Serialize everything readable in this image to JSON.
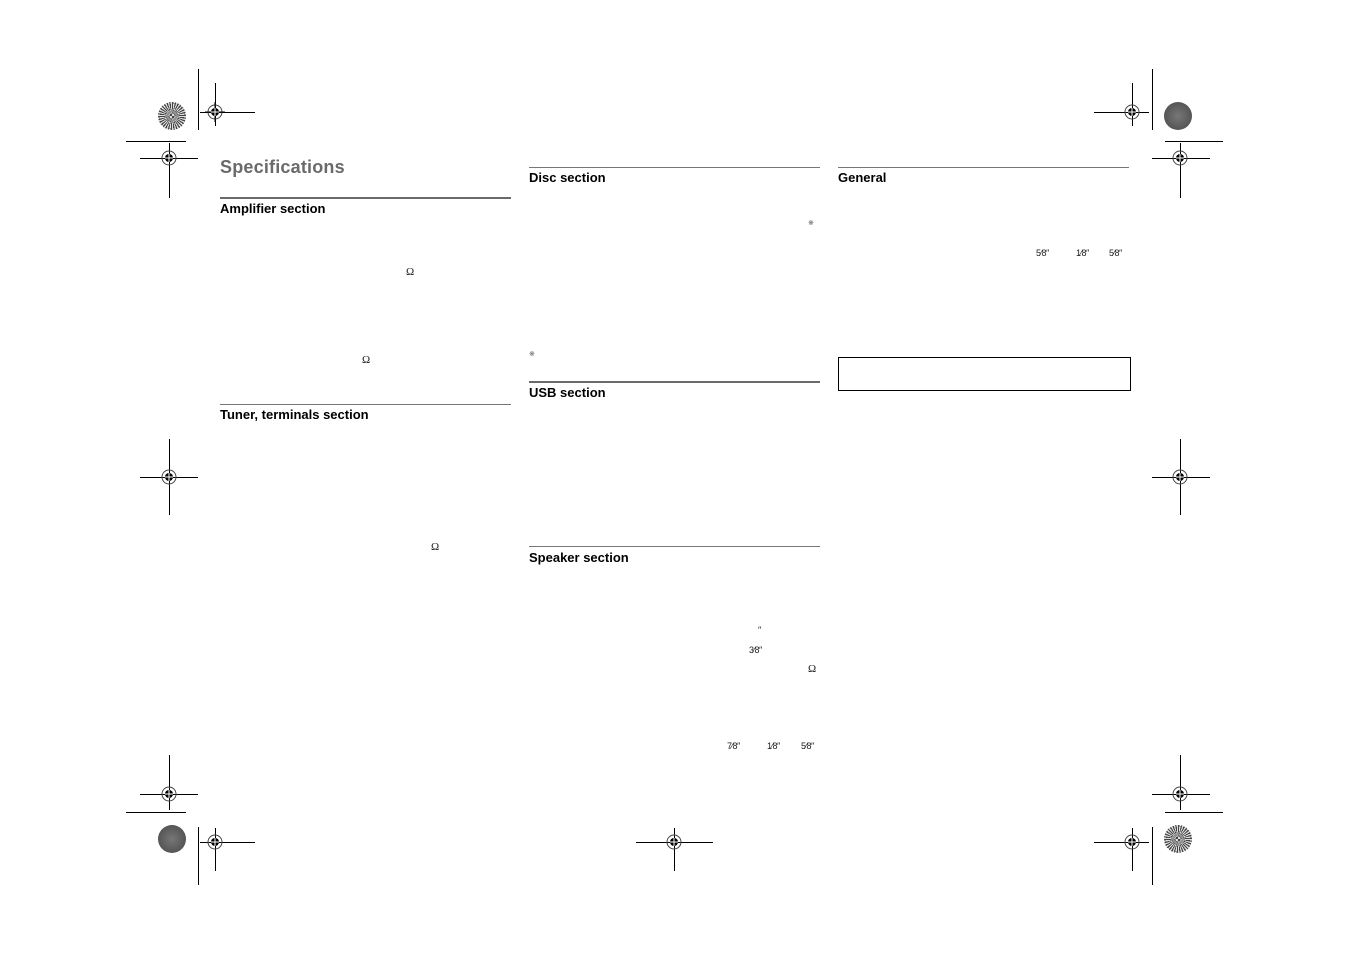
{
  "document": {
    "title": "Specifications",
    "columns": [
      {
        "sections": [
          {
            "heading": "Amplifier section",
            "symbols": [
              "Ω",
              "Ω"
            ]
          },
          {
            "heading": "Tuner, terminals section",
            "symbols": [
              "Ω"
            ]
          }
        ]
      },
      {
        "sections": [
          {
            "heading": "Disc section",
            "notes": [
              "※",
              "※"
            ]
          },
          {
            "heading": "USB section"
          },
          {
            "heading": "Speaker section",
            "symbols": [
              "″",
              "3⁄8″",
              "Ω",
              "7⁄8″",
              "1⁄8″",
              "5⁄8″"
            ]
          }
        ]
      },
      {
        "sections": [
          {
            "heading": "General",
            "symbols": [
              "5⁄8″",
              "1⁄8″",
              "5⁄8″"
            ]
          }
        ],
        "note_box_text": ""
      }
    ]
  },
  "registration_marks": {
    "crosshair_icon": "registration-crosshair",
    "starburst_icon": "color-target-starburst"
  }
}
